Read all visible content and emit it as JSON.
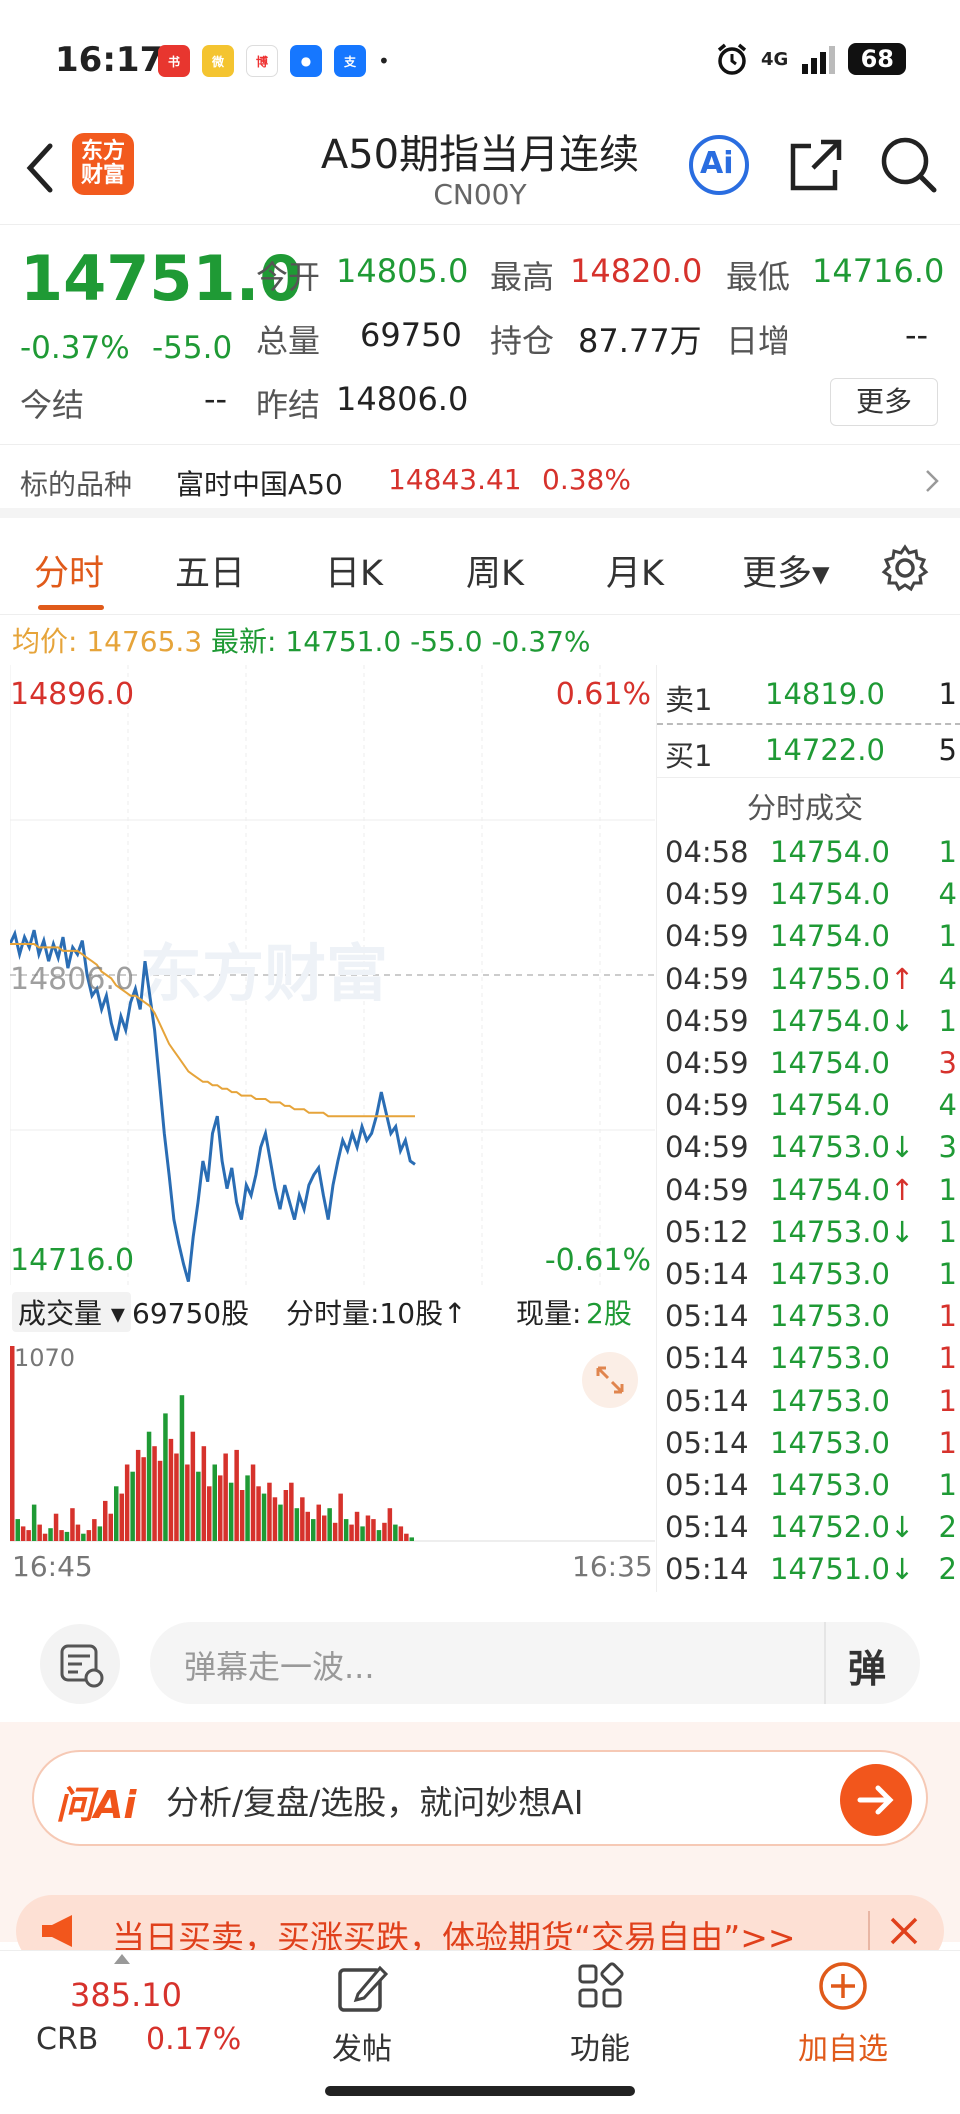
{
  "status_bar": {
    "time": "16:17",
    "network": "4G",
    "battery": "68"
  },
  "header": {
    "back_icon": "chevron-left-icon",
    "logo_line1": "东方",
    "logo_line2": "财富",
    "title": "A50期指当月连续",
    "code": "CN00Y",
    "ai_label": "Ai"
  },
  "quote": {
    "price": "14751.0",
    "change_pct": "-0.37%",
    "change": "-55.0",
    "open_label": "今开",
    "open": "14805.0",
    "high_label": "最高",
    "high": "14820.0",
    "low_label": "最低",
    "low": "14716.0",
    "volume_label": "总量",
    "volume": "69750",
    "oi_label": "持仓",
    "oi": "87.77万",
    "daily_inc_label": "日增",
    "daily_inc": "--",
    "settle_label": "今结",
    "settle": "--",
    "prev_settle_label": "昨结",
    "prev_settle": "14806.0",
    "more_label": "更多"
  },
  "underlying": {
    "label": "标的品种",
    "name": "富时中国A50",
    "price": "14843.41",
    "change_pct": "0.38%"
  },
  "tabs": [
    "分时",
    "五日",
    "日K",
    "周K",
    "月K",
    "更多▾"
  ],
  "avg_line": {
    "avg_label": "均价:",
    "avg_value": "14765.3",
    "latest_label": "最新:",
    "latest_value": "14751.0",
    "change": "-55.0",
    "change_pct": "-0.37%"
  },
  "chart_labels": {
    "top_price": "14896.0",
    "top_pct": "0.61%",
    "bottom_price": "14716.0",
    "bottom_pct": "-0.61%",
    "mid_price": "14806.0",
    "watermark": "东方财富",
    "vol_selector": "成交量 ▾",
    "vol_total": "69750股",
    "vol_per_min": "分时量:10股↑",
    "vol_now_label": "现量:",
    "vol_now": "2股",
    "vol_max": "1070",
    "time_start": "16:45",
    "time_end": "16:35"
  },
  "chart_data": {
    "type": "line",
    "ylim": [
      14716.0,
      14896.0
    ],
    "reference": 14806.0,
    "series": [
      {
        "name": "",
        "values": [
          14815,
          14818,
          14812,
          14817,
          14814,
          14819,
          14812,
          14816,
          14810,
          14815,
          14811,
          14817,
          14808,
          14814,
          14812,
          14816,
          14806,
          14800,
          14802,
          14796,
          14800,
          14792,
          14787,
          14794,
          14790,
          14798,
          14802,
          14796,
          14810,
          14800,
          14790,
          14775,
          14760,
          14748,
          14735,
          14728,
          14722,
          14717,
          14730,
          14740,
          14752,
          14746,
          14760,
          14765,
          14752,
          14744,
          14750,
          14740,
          14735,
          14745,
          14742,
          14748,
          14756,
          14760,
          14752,
          14744,
          14738,
          14745,
          14740,
          14735,
          14742,
          14738,
          14745,
          14748,
          14750,
          14742,
          14735,
          14745,
          14752,
          14758,
          14755,
          14760,
          14756,
          14762,
          14758,
          14760,
          14765,
          14772,
          14766,
          14760,
          14762,
          14755,
          14758,
          14752,
          14751
        ]
      },
      {
        "name": "",
        "values": [
          14815,
          14815,
          14815,
          14815,
          14815,
          14815,
          14814,
          14814,
          14814,
          14814,
          14814,
          14813,
          14813,
          14813,
          14813,
          14812,
          14811,
          14810,
          14809,
          14807,
          14806,
          14805,
          14803,
          14802,
          14801,
          14800,
          14800,
          14799,
          14798,
          14797,
          14795,
          14792,
          14789,
          14786,
          14784,
          14782,
          14780,
          14778,
          14777,
          14776,
          14775,
          14775,
          14774,
          14774,
          14773,
          14773,
          14772,
          14772,
          14771,
          14771,
          14771,
          14770,
          14770,
          14770,
          14769,
          14769,
          14769,
          14768,
          14768,
          14767,
          14767,
          14767,
          14766,
          14766,
          14766,
          14766,
          14765,
          14765,
          14765,
          14765,
          14765,
          14765,
          14765,
          14765,
          14765,
          14765,
          14765,
          14765,
          14765,
          14765,
          14765,
          14765,
          14765,
          14765,
          14765
        ]
      }
    ],
    "volume": [
      1070,
      120,
      80,
      60,
      200,
      90,
      40,
      70,
      150,
      60,
      50,
      180,
      90,
      40,
      60,
      120,
      80,
      220,
      150,
      300,
      260,
      420,
      380,
      500,
      460,
      600,
      520,
      440,
      700,
      560,
      480,
      800,
      420,
      600,
      380,
      520,
      300,
      420,
      360,
      480,
      320,
      500,
      280,
      360,
      420,
      300,
      260,
      320,
      240,
      200,
      280,
      320,
      180,
      240,
      160,
      120,
      200,
      140,
      180,
      100,
      260,
      120,
      90,
      160,
      80,
      140,
      120,
      60,
      100,
      180,
      90,
      80,
      40,
      20
    ]
  },
  "order_book": {
    "sell1_label": "卖1",
    "sell1_price": "14819.0",
    "sell1_vol": "1",
    "buy1_label": "买1",
    "buy1_price": "14722.0",
    "buy1_vol": "5",
    "ticks_title": "分时成交",
    "ticks": [
      {
        "time": "04:58",
        "price": "14754.0",
        "arrow": "",
        "vol": "1",
        "vol_color": "#1f9a35"
      },
      {
        "time": "04:59",
        "price": "14754.0",
        "arrow": "",
        "vol": "4",
        "vol_color": "#1f9a35"
      },
      {
        "time": "04:59",
        "price": "14754.0",
        "arrow": "",
        "vol": "1",
        "vol_color": "#1f9a35"
      },
      {
        "time": "04:59",
        "price": "14755.0",
        "arrow": "↑",
        "vol": "4",
        "vol_color": "#1f9a35"
      },
      {
        "time": "04:59",
        "price": "14754.0",
        "arrow": "↓",
        "vol": "1",
        "vol_color": "#1f9a35"
      },
      {
        "time": "04:59",
        "price": "14754.0",
        "arrow": "",
        "vol": "3",
        "vol_color": "#d6322c"
      },
      {
        "time": "04:59",
        "price": "14754.0",
        "arrow": "",
        "vol": "4",
        "vol_color": "#1f9a35"
      },
      {
        "time": "04:59",
        "price": "14753.0",
        "arrow": "↓",
        "vol": "3",
        "vol_color": "#1f9a35"
      },
      {
        "time": "04:59",
        "price": "14754.0",
        "arrow": "↑",
        "vol": "1",
        "vol_color": "#1f9a35"
      },
      {
        "time": "05:12",
        "price": "14753.0",
        "arrow": "↓",
        "vol": "1",
        "vol_color": "#1f9a35"
      },
      {
        "time": "05:14",
        "price": "14753.0",
        "arrow": "",
        "vol": "1",
        "vol_color": "#1f9a35"
      },
      {
        "time": "05:14",
        "price": "14753.0",
        "arrow": "",
        "vol": "1",
        "vol_color": "#d6322c"
      },
      {
        "time": "05:14",
        "price": "14753.0",
        "arrow": "",
        "vol": "1",
        "vol_color": "#d6322c"
      },
      {
        "time": "05:14",
        "price": "14753.0",
        "arrow": "",
        "vol": "1",
        "vol_color": "#d6322c"
      },
      {
        "time": "05:14",
        "price": "14753.0",
        "arrow": "",
        "vol": "1",
        "vol_color": "#d6322c"
      },
      {
        "time": "05:14",
        "price": "14753.0",
        "arrow": "",
        "vol": "1",
        "vol_color": "#1f9a35"
      },
      {
        "time": "05:14",
        "price": "14752.0",
        "arrow": "↓",
        "vol": "2",
        "vol_color": "#1f9a35"
      },
      {
        "time": "05:14",
        "price": "14751.0",
        "arrow": "↓",
        "vol": "2",
        "vol_color": "#1f9a35"
      }
    ]
  },
  "danmu": {
    "placeholder": "弹幕走一波...",
    "toggle_label": "弹"
  },
  "ai": {
    "logo": "问Ai",
    "prompt": "分析/复盘/选股，就问妙想AI"
  },
  "banner": {
    "text": "当日买卖，买涨买跌，体验期货“交易自由”>>"
  },
  "bottom_nav": {
    "index_value": "385.10",
    "index_name": "CRB",
    "index_change": "0.17%",
    "post_label": "发帖",
    "function_label": "功能",
    "add_label": "加自选"
  },
  "colors": {
    "up": "#d6322c",
    "down": "#1f9a35",
    "accent": "#e05a1a",
    "price_line": "#2a6db4",
    "avg_line": "#e6a43a"
  }
}
